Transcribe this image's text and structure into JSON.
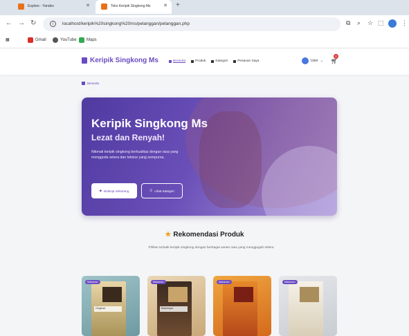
{
  "browser": {
    "tabs": [
      {
        "title": "Explore - Yandex"
      },
      {
        "title": "Toko Keripik Singkong Ms"
      }
    ],
    "url": "localhost/keripik%20singkong%20ms/pelanggan/pelanggan.php",
    "bookmarks": [
      {
        "label": "Gmail",
        "icon": "gmail-icon",
        "color": "#d93025"
      },
      {
        "label": "YouTube",
        "icon": "globe-icon",
        "color": "#555555"
      },
      {
        "label": "Maps",
        "icon": "maps-icon",
        "color": "#34a853"
      }
    ]
  },
  "site": {
    "brand": "Keripik Singkong Ms",
    "menu": [
      {
        "label": "Beranda",
        "icon": "home-icon",
        "active": true
      },
      {
        "label": "Produk",
        "icon": "box-icon",
        "active": false
      },
      {
        "label": "Kategori",
        "icon": "tag-icon",
        "active": false
      },
      {
        "label": "Pesanan Saya",
        "icon": "receipt-icon",
        "active": false
      }
    ],
    "user_label": "User",
    "cart_count": "0",
    "breadcrumb": "Beranda",
    "hero": {
      "title": "Keripik Singkong Ms",
      "subtitle": "Lezat dan Renyah!",
      "description": "Nikmati keripik singkong berkualitas dengan rasa yang menggoda selera dan tekstur yang sempurna.",
      "primary_button": "Belanja Sekarang",
      "secondary_button": "Lihat Kategori"
    },
    "recommend": {
      "title": "Rekomendasi Produk",
      "subtitle": "Pilihan terbaik keripik singkong dengan berbagai varian rasa yang menggugah selera"
    },
    "products": [
      {
        "tag": "Makanan",
        "label": "Original"
      },
      {
        "tag": "Makanan",
        "label": "Barbeque"
      },
      {
        "tag": "Makanan",
        "label": ""
      },
      {
        "tag": "Makanan",
        "label": ""
      }
    ]
  },
  "colors": {
    "accent": "#6b4bc2",
    "hero_start": "#4f3aa0",
    "hero_end": "#a995d8",
    "star": "#f0a020",
    "badge": "#e03c3c"
  }
}
